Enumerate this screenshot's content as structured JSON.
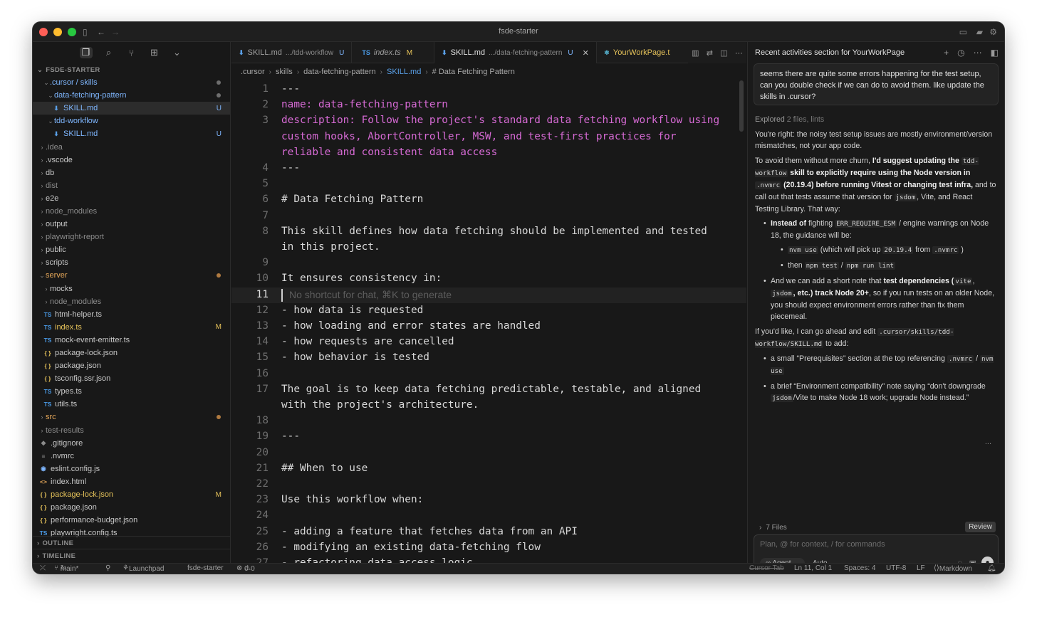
{
  "window": {
    "title": "fsde-starter",
    "traffic_lights": {
      "close": "#ff5f57",
      "minimize": "#febc2e",
      "zoom": "#28c840"
    }
  },
  "sidebar": {
    "section_title": "FSDE-STARTER",
    "icons": [
      "files-icon",
      "search-icon",
      "source-control-icon",
      "extensions-icon",
      "chevron-down-icon"
    ],
    "tree": [
      {
        "label": ".cursor / skills",
        "kind": "folder-open",
        "color": "blue"
      },
      {
        "label": "data-fetching-pattern",
        "kind": "folder-open",
        "color": "blue"
      },
      {
        "label": "SKILL.md",
        "kind": "md",
        "status": "U",
        "color": "blue"
      },
      {
        "label": "tdd-workflow",
        "kind": "folder-open",
        "color": "blue"
      },
      {
        "label": "SKILL.md",
        "kind": "md",
        "status": "U",
        "color": "blue"
      },
      {
        "label": ".idea",
        "kind": "folder",
        "color": "gray"
      },
      {
        "label": ".vscode",
        "kind": "folder"
      },
      {
        "label": "db",
        "kind": "folder"
      },
      {
        "label": "dist",
        "kind": "folder",
        "color": "gray"
      },
      {
        "label": "e2e",
        "kind": "folder"
      },
      {
        "label": "node_modules",
        "kind": "folder",
        "color": "gray"
      },
      {
        "label": "output",
        "kind": "folder"
      },
      {
        "label": "playwright-report",
        "kind": "folder",
        "color": "gray"
      },
      {
        "label": "public",
        "kind": "folder"
      },
      {
        "label": "scripts",
        "kind": "folder"
      },
      {
        "label": "server",
        "kind": "folder-open",
        "color": "orange"
      },
      {
        "label": "mocks",
        "kind": "folder"
      },
      {
        "label": "node_modules",
        "kind": "folder",
        "color": "gray"
      },
      {
        "label": "html-helper.ts",
        "kind": "ts"
      },
      {
        "label": "index.ts",
        "kind": "ts",
        "status": "M",
        "color": "yellow"
      },
      {
        "label": "mock-event-emitter.ts",
        "kind": "ts"
      },
      {
        "label": "package-lock.json",
        "kind": "json"
      },
      {
        "label": "package.json",
        "kind": "json"
      },
      {
        "label": "tsconfig.ssr.json",
        "kind": "json"
      },
      {
        "label": "types.ts",
        "kind": "ts"
      },
      {
        "label": "utils.ts",
        "kind": "ts"
      },
      {
        "label": "src",
        "kind": "folder",
        "color": "orange"
      },
      {
        "label": "test-results",
        "kind": "folder",
        "color": "gray"
      },
      {
        "label": ".gitignore",
        "kind": "git"
      },
      {
        "label": ".nvmrc",
        "kind": "text"
      },
      {
        "label": "eslint.config.js",
        "kind": "eslint"
      },
      {
        "label": "index.html",
        "kind": "html"
      },
      {
        "label": "package-lock.json",
        "kind": "json",
        "status": "M",
        "color": "yellow"
      },
      {
        "label": "package.json",
        "kind": "json"
      },
      {
        "label": "performance-budget.json",
        "kind": "json"
      },
      {
        "label": "playwright.config.ts",
        "kind": "ts"
      }
    ],
    "outline_label": "OUTLINE",
    "timeline_label": "TIMELINE"
  },
  "editor": {
    "tabs": [
      {
        "icon": "markdown-icon",
        "name": "SKILL.md",
        "path": ".../tdd-workflow",
        "status": "U"
      },
      {
        "icon": "TS",
        "name": "index.ts",
        "path": "",
        "status": "M"
      },
      {
        "icon": "markdown-icon",
        "name": "SKILL.md",
        "path": ".../data-fetching-pattern",
        "status": "U",
        "close": "✕"
      },
      {
        "icon": "react-icon",
        "name": "YourWorkPage.t",
        "path": "",
        "status": ""
      }
    ],
    "breadcrumb": [
      ".cursor",
      "skills",
      "data-fetching-pattern",
      "SKILL.md",
      "# Data Fetching Pattern"
    ],
    "lines": [
      {
        "n": "1",
        "text": "---"
      },
      {
        "n": "2",
        "text": "name: data-fetching-pattern",
        "style": "pink"
      },
      {
        "n": "3",
        "text": "description: Follow the project's standard data fetching workflow using",
        "style": "pink"
      },
      {
        "n": "",
        "text": "custom hooks, AbortController, MSW, and test-first practices for",
        "style": "pink"
      },
      {
        "n": "",
        "text": "reliable and consistent data access",
        "style": "pink"
      },
      {
        "n": "4",
        "text": "---"
      },
      {
        "n": "5",
        "text": ""
      },
      {
        "n": "6",
        "text": "# Data Fetching Pattern"
      },
      {
        "n": "7",
        "text": ""
      },
      {
        "n": "8",
        "text": "This skill defines how data fetching should be implemented and tested"
      },
      {
        "n": "",
        "text": "in this project."
      },
      {
        "n": "9",
        "text": ""
      },
      {
        "n": "10",
        "text": "It ensures consistency in:"
      },
      {
        "n": "11",
        "text": "No shortcut for chat, ⌘K to generate",
        "style": "ghost",
        "current": true
      },
      {
        "n": "12",
        "text": "- how data is requested"
      },
      {
        "n": "13",
        "text": "- how loading and error states are handled"
      },
      {
        "n": "14",
        "text": "- how requests are cancelled"
      },
      {
        "n": "15",
        "text": "- how behavior is tested"
      },
      {
        "n": "16",
        "text": ""
      },
      {
        "n": "17",
        "text": "The goal is to keep data fetching predictable, testable, and aligned"
      },
      {
        "n": "",
        "text": "with the project's architecture."
      },
      {
        "n": "18",
        "text": ""
      },
      {
        "n": "19",
        "text": "---"
      },
      {
        "n": "20",
        "text": ""
      },
      {
        "n": "21",
        "text": "## When to use"
      },
      {
        "n": "22",
        "text": ""
      },
      {
        "n": "23",
        "text": "Use this workflow when:"
      },
      {
        "n": "24",
        "text": ""
      },
      {
        "n": "25",
        "text": "- adding a feature that fetches data from an API"
      },
      {
        "n": "26",
        "text": "- modifying an existing data-fetching flow"
      },
      {
        "n": "27",
        "text": "- refactoring data access logic"
      }
    ]
  },
  "chat": {
    "title": "Recent activities section for YourWorkPage",
    "header_icons": [
      "plus-icon",
      "history-icon",
      "more-icon",
      "panel-icon"
    ],
    "user_message": "seems there are quite some errors happening for the test setup, can you double check if we can do to avoid them. like update the skills in .cursor?",
    "explored_label": "Explored",
    "explored_detail": "2 files, lints",
    "para1": "You're right: the noisy test setup issues are mostly environment/version mismatches, not your app code.",
    "para2_a": "To avoid them without more churn, ",
    "para2_b": "I'd suggest updating the",
    "para2_code1": "tdd-workflow",
    "para2_c": "skill to explicitly require using the Node version in",
    "para2_code2": ".nvmrc",
    "para2_d": "(20.19.4) before running Vitest or changing test infra,",
    "para2_e": "and to call out that tests assume that version for",
    "para2_code3": "jsdom",
    "para2_f": ", Vite, and React Testing Library. That way:",
    "b1_a": "Instead of",
    "b1_b": "fighting",
    "b1_code": "ERR_REQUIRE_ESM",
    "b1_c": "/ engine warnings on Node 18, the guidance will be:",
    "b1_s1_code1": "nvm use",
    "b1_s1_text": "(which will pick up",
    "b1_s1_code2": "20.19.4",
    "b1_s1_from": "from",
    "b1_s1_code3": ".nvmrc",
    "b1_s1_end": ")",
    "b1_s2_then": "then",
    "b1_s2_code1": "npm test",
    "b1_s2_slash": "/",
    "b1_s2_code2": "npm run lint",
    "b2_a": "And we can add a short note that",
    "b2_b": "test dependencies (",
    "b2_code1": "vite",
    "b2_code2": "jsdom",
    "b2_c": ", etc.) track Node 20+",
    "b2_d": ", so if you run tests on an older Node, you should expect environment errors rather than fix them piecemeal.",
    "para3_a": "If you'd like, I can go ahead and edit",
    "para3_code": ".cursor/skills/tdd-workflow/SKILL.md",
    "para3_b": "to add:",
    "c1_a": "a small “Prerequisites” section at the top referencing",
    "c1_code1": ".nvmrc",
    "c1_slash": "/",
    "c1_code2": "nvm use",
    "c2_a": "a brief “Environment compatibility” note saying “don't downgrade",
    "c2_code": "jsdom",
    "c2_b": "/Vite to make Node 18 work; upgrade Node instead.”",
    "more": "...",
    "files_label": "7 Files",
    "review_label": "Review",
    "input_placeholder": "Plan, @ for context, / for commands",
    "agent_label": "Agent",
    "auto_label": "Auto"
  },
  "statusbar": {
    "branch": "main*",
    "launchpad": "Launchpad",
    "project": "fsde-starter",
    "errors": "0",
    "warnings": "0",
    "cursor_tab": "Cursor Tab",
    "position": "Ln 11, Col 1",
    "spaces": "Spaces: 4",
    "encoding": "UTF-8",
    "eol": "LF",
    "language": "Markdown"
  },
  "colors": {
    "background": "#181818",
    "frontmatter": "#d66ad4",
    "untracked": "#7fb7ff",
    "modified": "#e6c35a"
  }
}
